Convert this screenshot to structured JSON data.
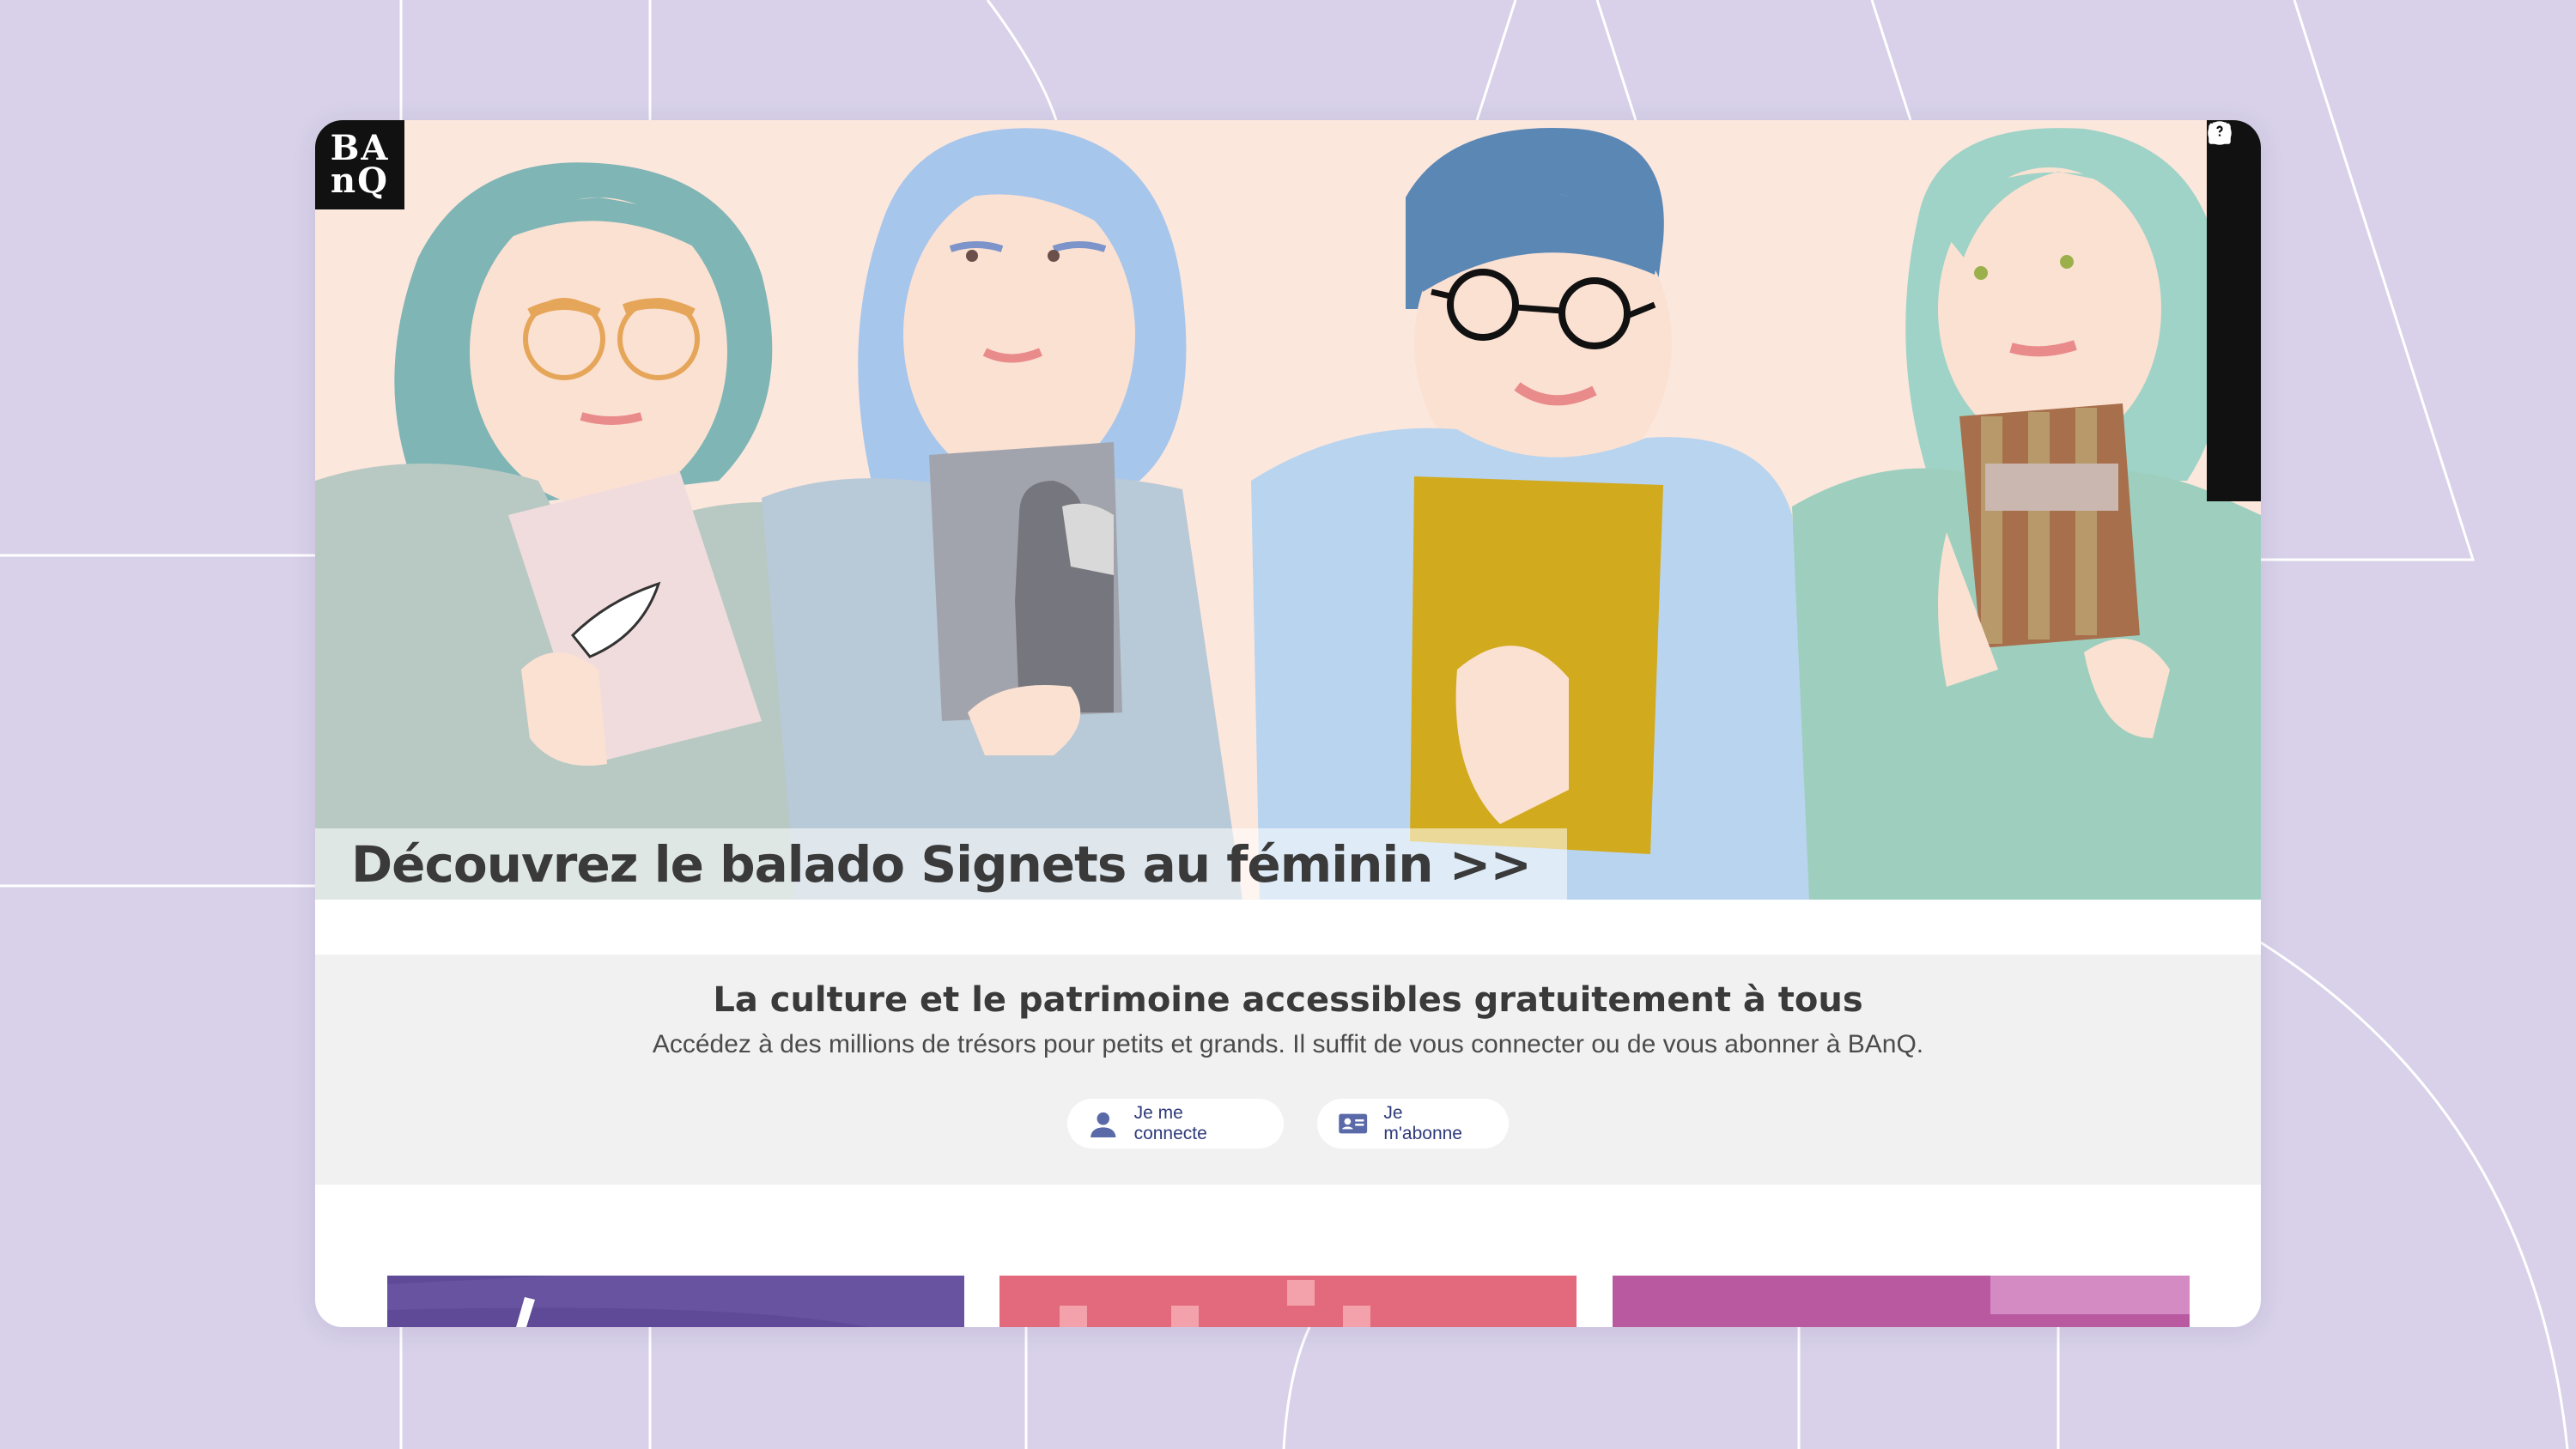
{
  "logo": {
    "text_line1": "BA",
    "text_line2": "nQ"
  },
  "hero": {
    "caption": "Découvrez le balado Signets au féminin >>"
  },
  "toolbar": {
    "icons": [
      "menu-icon",
      "search-icon",
      "user-icon",
      "location-pin-icon",
      "calendar-icon",
      "accessibility-icon",
      "help-icon"
    ]
  },
  "promo": {
    "title": "La culture et le patrimoine accessibles gratuitement à tous",
    "subtitle": "Accédez à des millions de trésors pour petits et grands. Il suffit de vous connecter ou de vous abonner à BAnQ.",
    "login_label": "Je me connecte",
    "subscribe_label": "Je m'abonne"
  },
  "colors": {
    "background": "#d8d1e9",
    "hero_bg": "#fce7dd",
    "card_purple": "#5e4a97",
    "card_pink": "#e26a7c",
    "card_magenta": "#b95aa1",
    "button_text": "#2f3a7a"
  }
}
